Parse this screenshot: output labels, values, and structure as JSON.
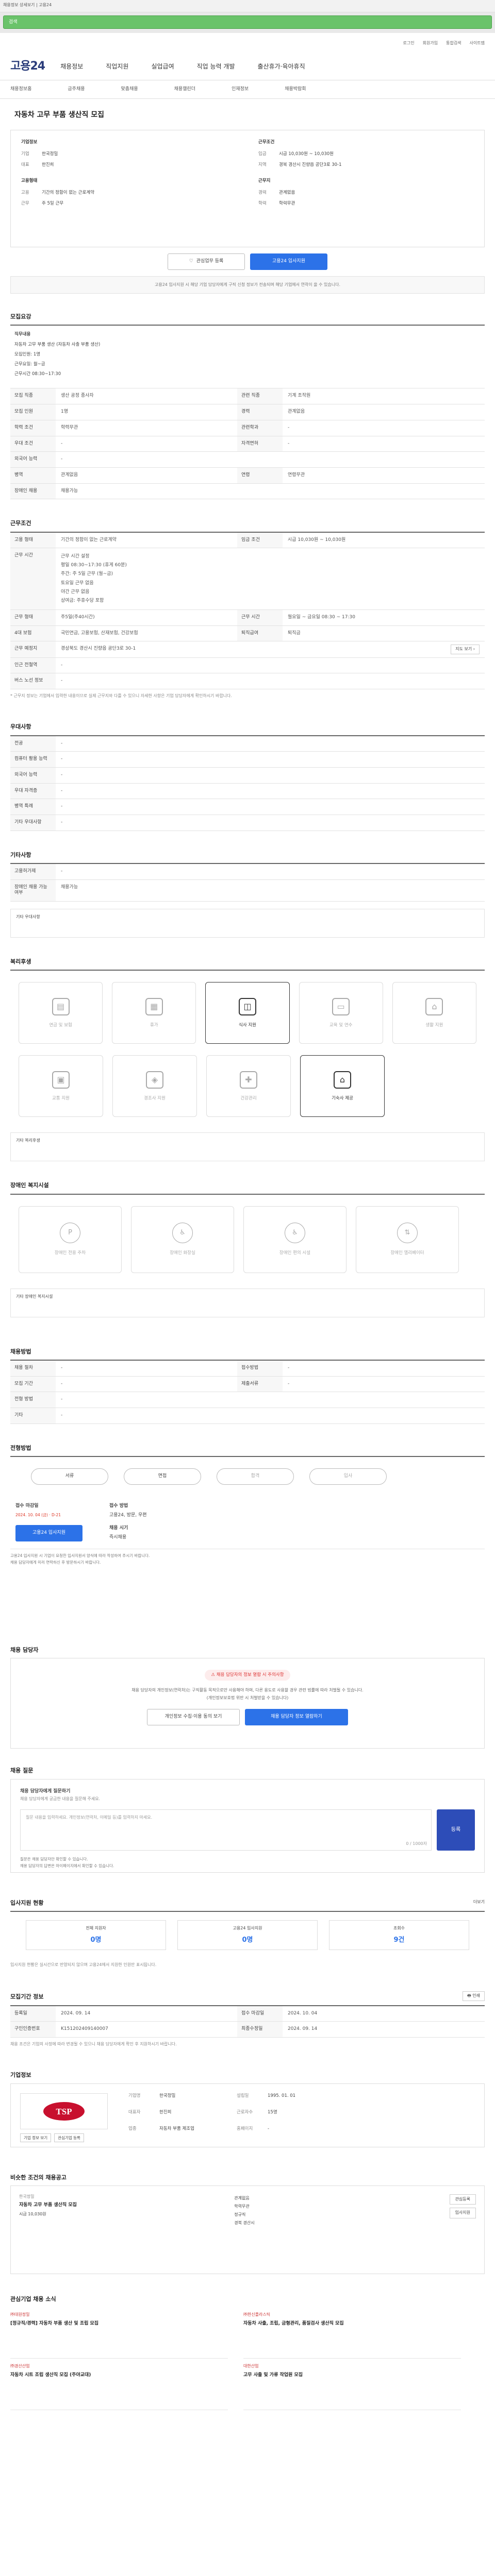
{
  "browser": {
    "title": "채용정보 상세보기 | 고용24",
    "url": "검색"
  },
  "util": [
    "로그인",
    "회원가입",
    "통합검색",
    "사이트맵"
  ],
  "logo": "고용24",
  "nav": [
    "채용정보",
    "직업지원",
    "실업급여",
    "직업 능력 개발",
    "출산휴가·육아휴직"
  ],
  "subnav": [
    "채용정보홈",
    "금주채용",
    "맞춤채용",
    "채용캘린더",
    "인재정보",
    "채용박람회"
  ],
  "job": {
    "title": "자동차 고무 부품 생산직 모집",
    "company_label": "기업정보",
    "company_name_label": "기업",
    "company_name": "한국정밀",
    "ceo_label": "대표",
    "ceo": "한진희",
    "work_label": "고용형태",
    "work_type": "기간의 정함이 없는 근로계약",
    "hours_label": "근무형태",
    "hours": "주 5일 근무",
    "cond_label": "근무조건",
    "pay_label": "임금",
    "pay": "시급 10,030원 ~ 10,030원",
    "loc_label": "지역",
    "loc": "경북 경산시 진량읍 공단3로 30-1",
    "area_label": "근무지",
    "area": "경상북도 경산시",
    "edu_label": "경력",
    "edu": "관계없음",
    "exp_label": "학력",
    "exp": "학력무관"
  },
  "buttons": {
    "scrap": "관심업무 등록",
    "apply": "고용24 입사지원"
  },
  "notice": "고용24 입사지원 시 해당 기업 담당자에게 구직 신청 정보가 전송되며 해당 기업에서 연락이 올 수 있습니다.",
  "sections": {
    "recruit": "모집요강",
    "conditions": "근무조건",
    "welfare_req": "우대사항",
    "etc": "기타사항",
    "welfare": "복리후생",
    "disability": "장애인 복지시설",
    "method": "채용방법",
    "procedure": "전형방법",
    "contact": "채용 담당자",
    "qa": "채용 질문",
    "history": "입사지원 현황",
    "period": "모집기간 정보",
    "company": "기업정보",
    "similar": "비슷한 조건의 채용공고",
    "feed": "관심기업 채용 소식"
  },
  "intro": [
    "직무내용",
    "자동차 고무 부품 생산 (자동차 사출 부품 생산)",
    "모집인원: 1명",
    "근무요일: 월~금",
    "근무시간 08:30~17:30"
  ],
  "recruit_rows": [
    [
      "모집 직종",
      "생산 공정 종사자",
      "관련 직종",
      "기계 조작원"
    ],
    [
      "모집 인원",
      "1명",
      "경력",
      "관계없음"
    ],
    [
      "학력 조건",
      "학력무관",
      "관련학과",
      "-"
    ],
    [
      "우대 조건",
      "-",
      "자격면허",
      "-"
    ],
    [
      "외국어 능력",
      "-",
      "",
      ""
    ],
    [
      "병역",
      "관계없음",
      "연령",
      "연령무관"
    ],
    [
      "장애인 채용",
      "채용가능",
      "",
      ""
    ]
  ],
  "cond_rows": [
    [
      "고용 형태",
      "기간의 정함이 없는 근로계약",
      "임금 조건",
      "시급 10,030원 ~ 10,030원"
    ],
    [
      "근무 형태",
      "주5일(주40시간)",
      "근무 시간",
      "월요일 ~ 금요일 08:30 ~ 17:30"
    ],
    [
      "4대 보험",
      "국민연금, 고용보험, 산재보험, 건강보험",
      "퇴직급여",
      "퇴직금"
    ],
    [
      "근무 예정지",
      "경상북도 경산시 진량읍 공단3로 30-1",
      "",
      ""
    ],
    [
      "인근 전철역",
      "-",
      "",
      ""
    ],
    [
      "버스 노선 정보",
      "-",
      "",
      ""
    ]
  ],
  "worktime": [
    "근무 시간 설정",
    "평일 08:30~17:30 (휴게 60분)",
    "주간: 주 5일 근무 (월~금)",
    "토요일 근무 없음",
    "야간 근무 없음",
    "상여금: 주휴수당 포함"
  ],
  "cond_note": "* 근무지 정보는 기업에서 입력한 내용이므로 실제 근무지와 다를 수 있으니 자세한 사항은 기업 담당자에게 확인하시기 바랍니다.",
  "pref_rows": [
    [
      "전공",
      "-"
    ],
    [
      "컴퓨터 활용 능력",
      "-"
    ],
    [
      "외국어 능력",
      "-"
    ],
    [
      "우대 자격증",
      "-"
    ],
    [
      "병역 특례",
      "-"
    ],
    [
      "기타 우대사항",
      "-"
    ]
  ],
  "etc_rows": [
    [
      "고용허가제",
      "-"
    ],
    [
      "장애인 채용 가능 여부",
      "채용가능"
    ]
  ],
  "etc_link": "기타 우대사항",
  "welfare_items": [
    "연금 및 보험",
    "휴가",
    "식사 지원",
    "교육 및 연수",
    "생활 지원",
    "교통 지원",
    "경조사 지원",
    "건강관리",
    "자녀교육",
    "기숙사 제공"
  ],
  "welfare_note": "기타 복리후생",
  "disability_items": [
    "장애인 전용 주차",
    "장애인 화장실",
    "장애인 편의 시설",
    "장애인 엘리베이터"
  ],
  "disability_note": "기타 장애인 복지시설",
  "method_rows": [
    [
      "채용 절차",
      "-",
      "접수방법",
      "-"
    ],
    [
      "모집 기간",
      "-",
      "제출서류",
      "-"
    ],
    [
      "전형 방법",
      "-",
      "",
      ""
    ],
    [
      "기타",
      "-",
      "",
      ""
    ]
  ],
  "proc": [
    "서류",
    "면접",
    "합격",
    "입사"
  ],
  "apply": {
    "period_label": "접수 마감일",
    "period": "2024. 10. 04 (금) · D-21",
    "method_label": "접수 방법",
    "method": "고용24, 방문, 우편",
    "result_label": "채용 시기",
    "result": "즉시채용",
    "btn": "고용24 입사지원"
  },
  "apply_notes": [
    "고용24 입사지원 시 기업이 요청한 입사지원서 양식에 따라 작성하여 주시기 바랍니다.",
    "채용 담당자에게 미리 연락하신 후 방문하시기 바랍니다."
  ],
  "contact": {
    "warn": "채용 담당자의 정보 열람 시 주의사항",
    "desc1": "채용 담당자의 개인정보(연락처)는 구직활동 목적으로만 사용해야 하며, 다른 용도로 사용할 경우 관련 법률에 따라 처벌될 수 있습니다.",
    "desc2": "(개인정보보호법 위반 시 처벌받을 수 있습니다)",
    "btn1": "개인정보 수집·이용 동의 보기",
    "btn2": "채용 담당자 정보 열람하기"
  },
  "qa": {
    "label": "채용 담당자에게 질문하기",
    "guide": "채용 담당자에게 궁금한 내용을 질문해 주세요.",
    "placeholder": "질문 내용을 입력하세요. 개인정보(연락처, 이메일 등)를 입력하지 마세요.",
    "count": "0 / 1000자",
    "btn": "등록",
    "notes": [
      "질문은 채용 담당자만 확인할 수 있습니다.",
      "채용 담당자의 답변은 마이페이지에서 확인할 수 있습니다."
    ]
  },
  "history": {
    "more": "더보기",
    "cards": [
      [
        "전체 지원자",
        "0명"
      ],
      [
        "고용24 입사지원",
        "0명"
      ],
      [
        "조회수",
        "9건"
      ]
    ]
  },
  "history_note": "입사지원 현황은 실시간으로 반영되지 않으며 고용24에서 지원한 인원만 표시됩니다.",
  "period_rows": [
    [
      "등록일",
      "2024. 09. 14",
      "접수 마감일",
      "2024. 10. 04"
    ],
    [
      "구인인증번호",
      "K151202409140007",
      "최종수정일",
      "2024. 09. 14"
    ]
  ],
  "period_note": "채용 조건은 기업의 사정에 따라 변경될 수 있으니 채용 담당자에게 확인 후 지원하시기 바랍니다.",
  "company": {
    "name": "한국정밀",
    "ceo": "한진희",
    "founded": "1995. 01. 01",
    "employees": "15명",
    "industry": "자동차 부품 제조업",
    "site": "-",
    "btn1": "기업 정보 보기",
    "btn2": "관심기업 등록"
  },
  "similar": {
    "title": "자동차 고무 부품 생산직 모집",
    "company": "한국정밀",
    "pay": "시급 10,030원",
    "loc": "경북 경산시",
    "tags": [
      "관계없음",
      "학력무관",
      "정규직"
    ]
  },
  "feed": [
    [
      "㈜대원정밀",
      "[정규직/경력] 자동차 부품 생산 및 조립 모집"
    ],
    [
      "㈜한신플라스틱",
      "자동차 사출, 조립, 금형관리, 품질검사 생산직 모집"
    ],
    [
      "㈜경산산업",
      "자동차 시트 조립 생산직 모집 (주야교대)"
    ],
    [
      "대한산업",
      "고무 사출 및 가류 작업원 모집"
    ]
  ]
}
